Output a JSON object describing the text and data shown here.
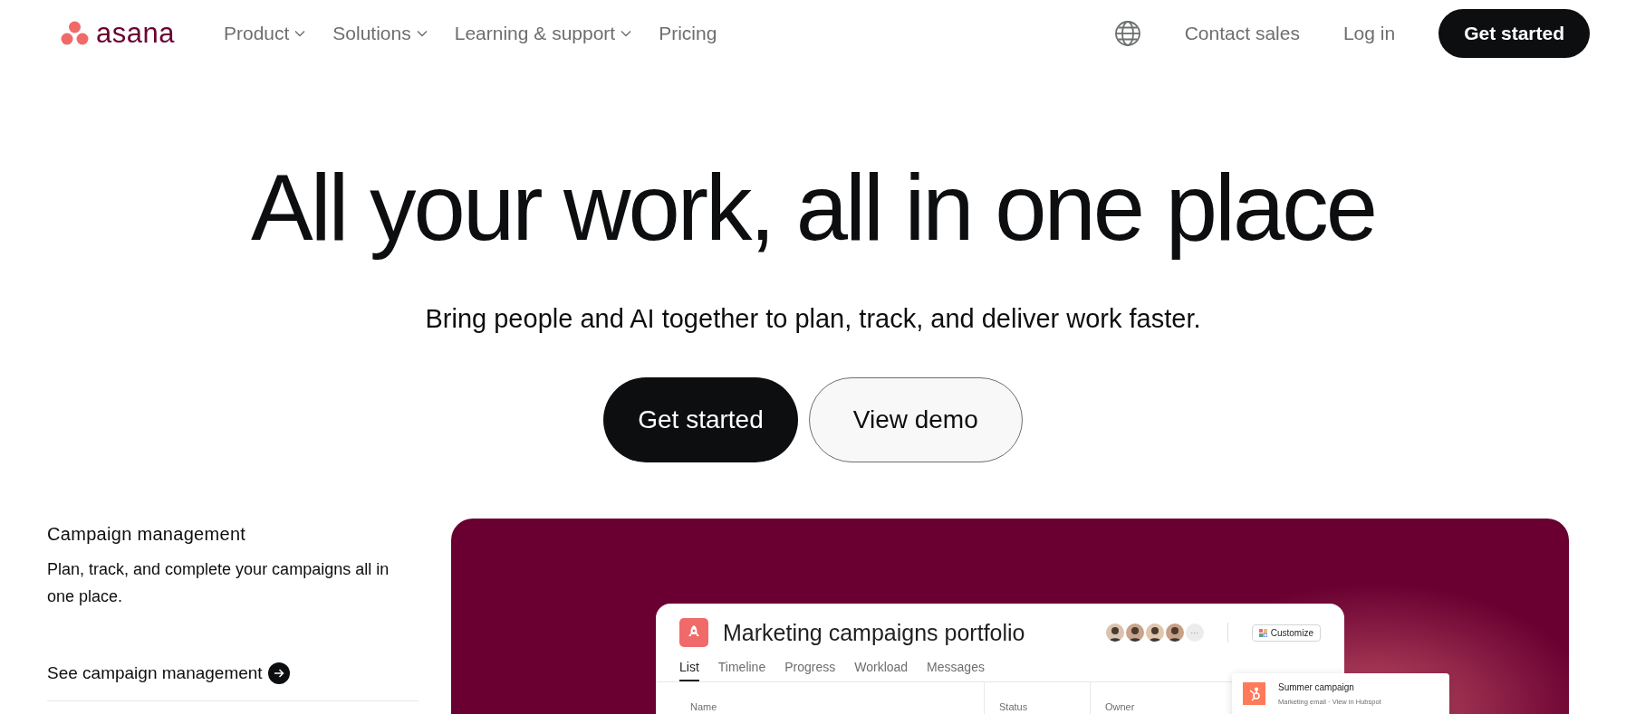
{
  "nav": {
    "logo": "asana",
    "menu": [
      {
        "label": "Product",
        "dropdown": true
      },
      {
        "label": "Solutions",
        "dropdown": true
      },
      {
        "label": "Learning & support",
        "dropdown": true
      },
      {
        "label": "Pricing",
        "dropdown": false
      }
    ],
    "contact": "Contact sales",
    "login": "Log in",
    "cta": "Get started"
  },
  "hero": {
    "title": "All your work, all in one place",
    "subtitle": "Bring people and AI together to plan, track, and deliver work faster.",
    "primary": "Get started",
    "secondary": "View demo"
  },
  "feature": {
    "title": "Campaign management",
    "description": "Plan, track, and complete your campaigns all in one place.",
    "link": "See campaign management"
  },
  "app": {
    "name": "Marketing campaigns portfolio",
    "customize": "Customize",
    "more": "···",
    "tabs": [
      {
        "label": "List",
        "selected": true
      },
      {
        "label": "Timeline",
        "selected": false
      },
      {
        "label": "Progress",
        "selected": false
      },
      {
        "label": "Workload",
        "selected": false
      },
      {
        "label": "Messages",
        "selected": false
      }
    ],
    "columns": [
      "Name",
      "Status",
      "Owner"
    ]
  },
  "notification": {
    "title": "Summer campaign",
    "source": "Marketing email",
    "separator": "·",
    "action": "View in Hubspot"
  }
}
